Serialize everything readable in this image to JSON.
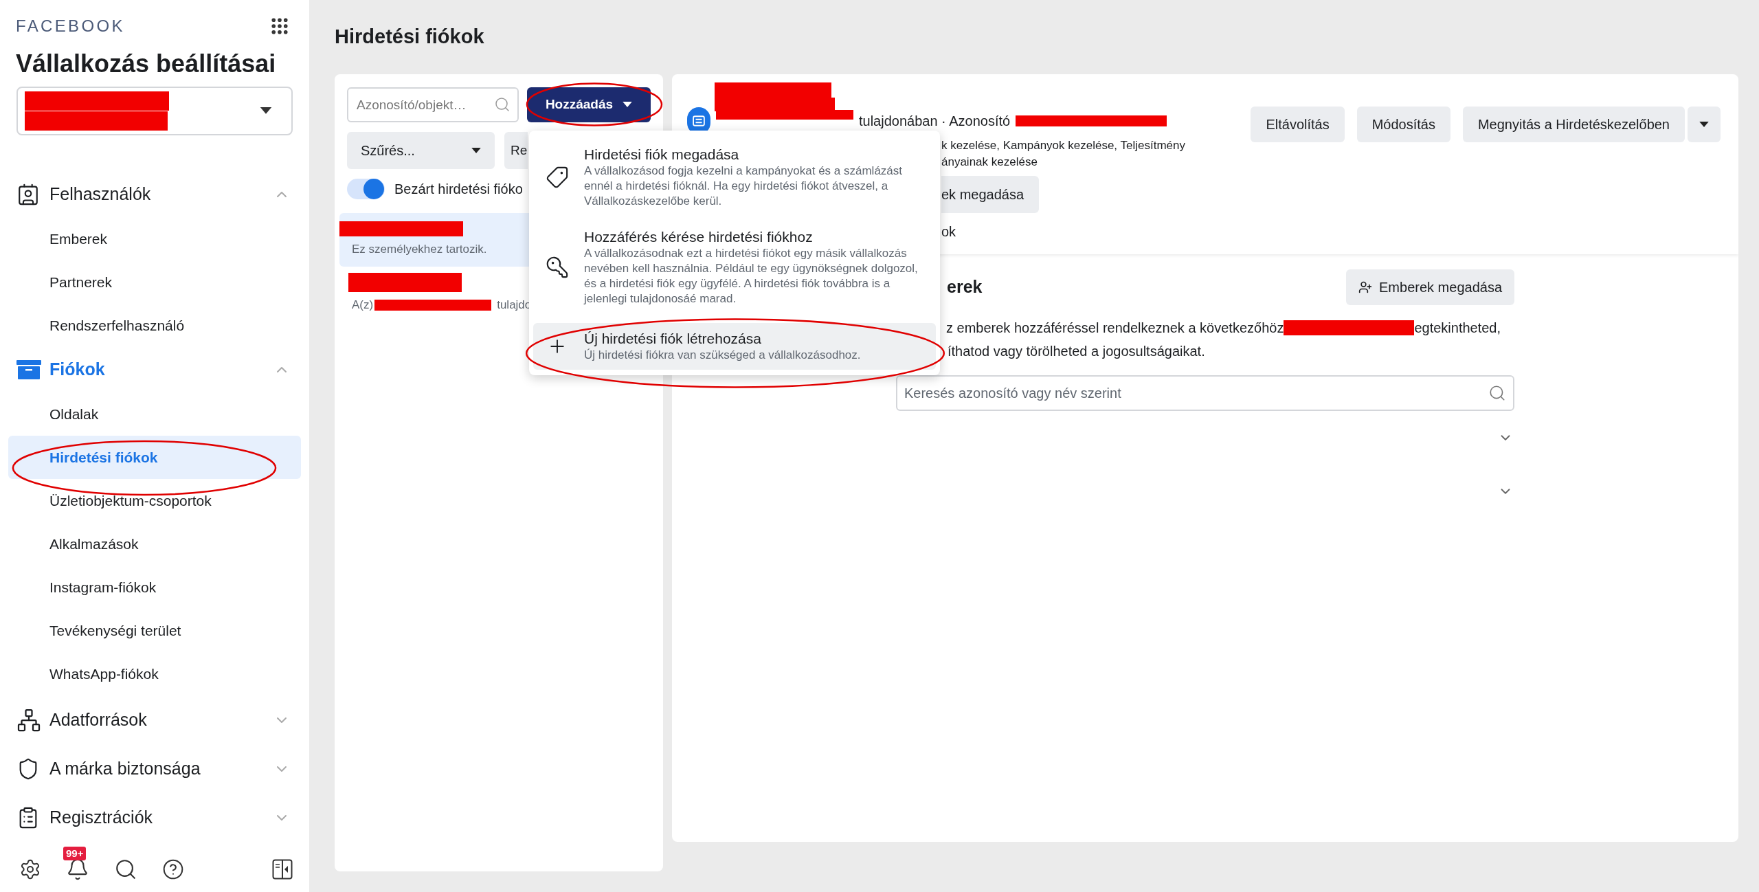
{
  "brand": "FACEBOOK",
  "title": "Vállalkozás beállításai",
  "nav": [
    {
      "label": "Felhasználók",
      "selected": false,
      "expanded": true,
      "children": [
        {
          "label": "Emberek",
          "selected": false
        },
        {
          "label": "Partnerek",
          "selected": false
        },
        {
          "label": "Rendszerfelhasználó",
          "selected": false
        }
      ]
    },
    {
      "label": "Fiókok",
      "selected": true,
      "expanded": true,
      "children": [
        {
          "label": "Oldalak",
          "selected": false
        },
        {
          "label": "Hirdetési fiókok",
          "selected": true
        },
        {
          "label": "Üzletiobjektum-csoportok",
          "selected": false
        },
        {
          "label": "Alkalmazások",
          "selected": false
        },
        {
          "label": "Instagram-fiókok",
          "selected": false
        },
        {
          "label": "Tevékenységi terület",
          "selected": false
        },
        {
          "label": "WhatsApp-fiókok",
          "selected": false
        }
      ]
    },
    {
      "label": "Adatforrások",
      "selected": false,
      "expanded": false
    },
    {
      "label": "A márka biztonsága",
      "selected": false,
      "expanded": false
    },
    {
      "label": "Regisztrációk",
      "selected": false,
      "expanded": false
    }
  ],
  "notification_badge": "99+",
  "page_title": "Hirdetési fiókok",
  "accounts": {
    "search_placeholder": "Azonosító/objekt…",
    "add_button": "Hozzáadás",
    "filter": "Szűrés...",
    "sort_button": "Re",
    "closed_toggle": {
      "label": "Bezárt hirdetési fióko",
      "on": true
    },
    "items": [
      {
        "subtitle": "Ez személyekhez tartozik.",
        "selected": true
      },
      {
        "subtitle_start": "A(z)",
        "subtitle_end": "tulajdo",
        "selected": false
      }
    ]
  },
  "add_menu": [
    {
      "title": "Hirdetési fiók megadása",
      "description": "A vállalkozásod fogja kezelni a kampányokat és a számlázást ennél a hirdetési fióknál. Ha egy hirdetési fiókot átveszel, a Vállalkozáskezelőbe kerül.",
      "highlighted": false
    },
    {
      "title": "Hozzáférés kérése hirdetési fiókhoz",
      "description": "A vállalkozásodnak ezt a hirdetési fiókot egy másik vállalkozás nevében kell használnia. Például te egy ügynökségnek dolgozol, és a hirdetési fiók egy ügyfélé. A hirdetési fiók továbbra is a jelenlegi tulajdonosáé marad.",
      "highlighted": false
    },
    {
      "title": "Új hirdetési fiók létrehozása",
      "description": "Új hirdetési fiókra van szükséged a vállalkozásodhoz.",
      "highlighted": true
    }
  ],
  "detail": {
    "owner_line": "tulajdonában · Azonosító",
    "permissions": [
      "k kezelése, Kampányok kezelése, Teljesítmény",
      "ányainak kezelése"
    ],
    "assign_button": "ek megadása",
    "tab_fragment": "ok",
    "actions": [
      "Eltávolítás",
      "Módosítás",
      "Megnyitás a Hirdetéskezelőben"
    ],
    "people": {
      "heading": "erek",
      "add_button": "Emberek megadása",
      "text_start": "z emberek hozzáféréssel rendelkeznek a következőhöz",
      "text_end": "egtekintheted,",
      "text_line2": "íthatod vagy törölheted a jogosultságaikat.",
      "search_placeholder": "Keresés azonosító vagy név szerint",
      "rows": [
        {
          "expanded": false
        },
        {
          "expanded": false
        }
      ]
    }
  }
}
